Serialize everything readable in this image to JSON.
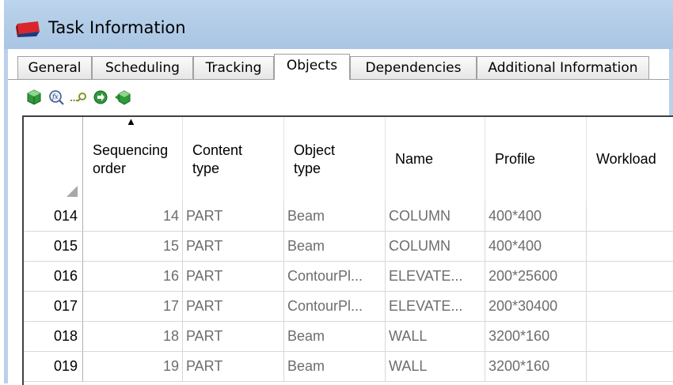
{
  "window": {
    "title": "Task Information"
  },
  "tabs": [
    {
      "label": "General",
      "active": false
    },
    {
      "label": "Scheduling",
      "active": false
    },
    {
      "label": "Tracking",
      "active": false
    },
    {
      "label": "Objects",
      "active": true
    },
    {
      "label": "Dependencies",
      "active": false
    },
    {
      "label": "Additional Information",
      "active": false
    }
  ],
  "toolbar": {
    "buttons": [
      "add-object-icon",
      "formula-search-icon",
      "link-key-icon",
      "go-arrow-icon",
      "import-object-icon"
    ]
  },
  "grid": {
    "sort_indicator": "▲",
    "columns": [
      "Sequencing\norder",
      "Content\ntype",
      "Object\ntype",
      "Name",
      "Profile",
      "Workload"
    ],
    "rows": [
      {
        "id": "014",
        "seq": "14",
        "content": "PART",
        "object": "Beam",
        "name": "COLUMN",
        "profile": "400*400",
        "workload": ""
      },
      {
        "id": "015",
        "seq": "15",
        "content": "PART",
        "object": "Beam",
        "name": "COLUMN",
        "profile": "400*400",
        "workload": ""
      },
      {
        "id": "016",
        "seq": "16",
        "content": "PART",
        "object": "ContourPl...",
        "name": "ELEVATE...",
        "profile": "200*25600",
        "workload": ""
      },
      {
        "id": "017",
        "seq": "17",
        "content": "PART",
        "object": "ContourPl...",
        "name": "ELEVATE...",
        "profile": "200*30400",
        "workload": ""
      },
      {
        "id": "018",
        "seq": "18",
        "content": "PART",
        "object": "Beam",
        "name": "WALL",
        "profile": "3200*160",
        "workload": ""
      },
      {
        "id": "019",
        "seq": "19",
        "content": "PART",
        "object": "Beam",
        "name": "WALL",
        "profile": "3200*160",
        "workload": ""
      }
    ]
  }
}
